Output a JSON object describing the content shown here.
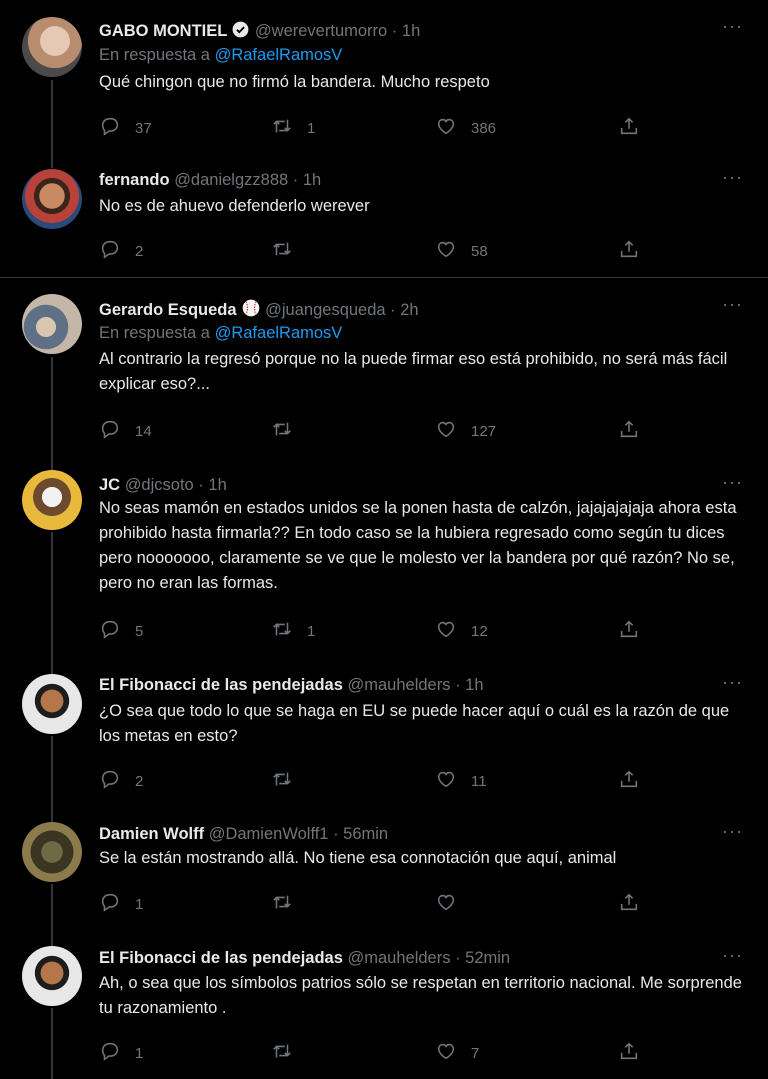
{
  "colors": {
    "background": "#000000",
    "text": "#e7e9ea",
    "muted": "#71767b",
    "link": "#1d9bf0",
    "divider": "#2f3336"
  },
  "tweets": [
    {
      "name": "GABO MONTIEL",
      "badge": "verified-icon",
      "handle": "@werevertumorro",
      "time": "1h",
      "reply_prefix": "En respuesta a",
      "reply_mention": "@RafaelRamosV",
      "text": "Qué chingon que no firmó la bandera. Mucho respeto",
      "replies": "37",
      "retweets": "1",
      "likes": "386"
    },
    {
      "name": "fernando",
      "handle": "@danielgzz888",
      "time": "1h",
      "text": "No es de ahuevo defenderlo werever",
      "replies": "2",
      "retweets": "",
      "likes": "58"
    },
    {
      "name": "Gerardo Esqueda",
      "badge": "baseball-icon",
      "handle": "@juangesqueda",
      "time": "2h",
      "reply_prefix": "En respuesta a",
      "reply_mention": "@RafaelRamosV",
      "text": "Al contrario la regresó porque no la puede firmar eso está prohibido, no será más fácil explicar eso?...",
      "replies": "14",
      "retweets": "",
      "likes": "127"
    },
    {
      "name": "JC",
      "handle": "@djcsoto",
      "time": "1h",
      "text": "No seas mamón en estados unidos se la ponen hasta de calzón, jajajajajaja ahora esta prohibido hasta firmarla?? En todo caso se la hubiera regresado como según tu dices pero nooooooo, claramente se ve que le molesto ver la bandera por qué razón? No se, pero no eran las formas.",
      "replies": "5",
      "retweets": "1",
      "likes": "12"
    },
    {
      "name": "El Fibonacci de las pendejadas",
      "handle": "@mauhelders",
      "time": "1h",
      "text": "¿O sea que todo lo que se haga en EU se puede hacer aquí o cuál es la razón de que los metas en esto?",
      "replies": "2",
      "retweets": "",
      "likes": "11"
    },
    {
      "name": "Damien Wolff",
      "handle": "@DamienWolff1",
      "time": "56min",
      "text": "Se la están mostrando allá. No tiene esa connotación que aquí, animal",
      "replies": "1",
      "retweets": "",
      "likes": ""
    },
    {
      "name": "El Fibonacci de las pendejadas",
      "handle": "@mauhelders",
      "time": "52min",
      "text": "Ah, o sea que los símbolos patrios sólo se respetan en territorio nacional. Me sorprende tu razonamiento .",
      "replies": "1",
      "retweets": "",
      "likes": "7"
    }
  ],
  "icons": {
    "more": "more-icon",
    "reply": "reply-icon",
    "retweet": "retweet-icon",
    "like": "heart-icon",
    "share": "share-icon"
  }
}
